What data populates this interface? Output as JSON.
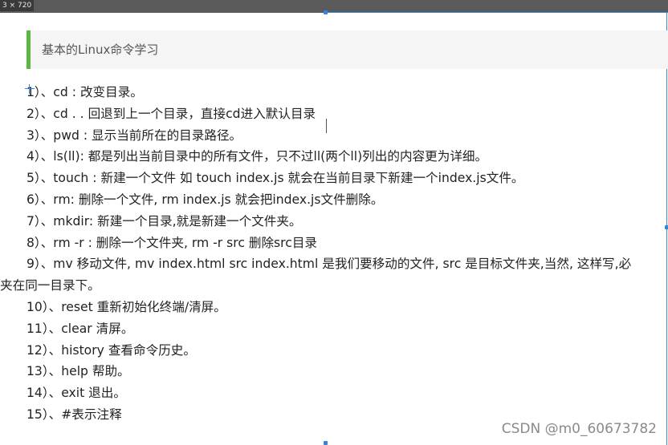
{
  "overlay": {
    "dimension_label": "3 × 720"
  },
  "heading": {
    "title": "基本的Linux命令学习"
  },
  "commands": [
    "1）、cd : 改变目录。",
    "2）、cd . . 回退到上一个目录，直接cd进入默认目录",
    "3）、pwd : 显示当前所在的目录路径。",
    "4）、ls(ll): 都是列出当前目录中的所有文件，只不过ll(两个ll)列出的内容更为详细。",
    "5）、touch : 新建一个文件 如 touch index.js 就会在当前目录下新建一个index.js文件。",
    "6）、rm:  删除一个文件, rm index.js 就会把index.js文件删除。",
    "7）、mkdir:  新建一个目录,就是新建一个文件夹。",
    "8）、rm -r :  删除一个文件夹, rm -r src 删除src目录",
    "9）、mv 移动文件, mv index.html src index.html 是我们要移动的文件, src 是目标文件夹,当然, 这样写,必",
    "10）、reset 重新初始化终端/清屏。",
    "11）、clear 清屏。",
    "12）、history 查看命令历史。",
    "13）、help 帮助。",
    "14）、exit 退出。",
    "15）、#表示注释"
  ],
  "command_9_continuation": "夹在同一目录下。",
  "watermark": "CSDN @m0_60673782",
  "colors": {
    "accent_bar": "#59b742",
    "heading_bg": "#f5f5f5",
    "selection": "#3a88d6"
  }
}
